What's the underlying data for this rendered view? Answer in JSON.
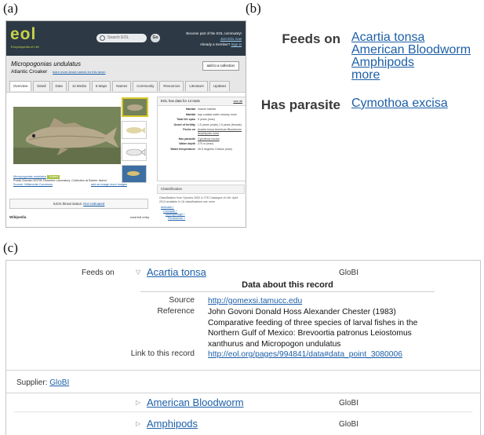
{
  "labels": {
    "a": "(a)",
    "b": "(b)",
    "c": "(c)"
  },
  "eol": {
    "logo": "eol",
    "tagline": "Encyclopedia of Life",
    "search_placeholder": "Search EOL",
    "go_label": "Go",
    "account": {
      "line1": "Become part of the EOL community!",
      "join_link": "Join EOL now",
      "line2": "Already a member?",
      "signin_link": "Sign in"
    },
    "scientific_name": "Micropogonias undulatus",
    "common_name": "Atlantic Croaker",
    "common_name_link": "learn more about names for this taxon",
    "add_to_collection": "add to a collection",
    "tabs": [
      "Overview",
      "Detail",
      "Data",
      "14 Media",
      "6 Maps",
      "Names",
      "Community",
      "Resources",
      "Literature",
      "Updates"
    ],
    "traits_header": "EOL has data for 14 traits",
    "see_all": "see all",
    "traits": [
      {
        "k": "Habitat",
        "v": "marine habitat"
      },
      {
        "k": "Habitat",
        "v": "bay coastal water estuary more"
      },
      {
        "k": "Total life span",
        "v": "9 years (max)"
      },
      {
        "k": "Onset of fertility",
        "v": "1.5 years (male) 1.5 years (female)"
      },
      {
        "k": "Feeds on",
        "v": "Acartia tonsa American Bloodworm Amphipods more"
      },
      {
        "k": "Has parasite",
        "v": "Cymothoa excisa"
      },
      {
        "k": "Water depth",
        "v": "270 m (max)"
      },
      {
        "k": "Water temperature",
        "v": "26.5 degrees Celsius (max)"
      }
    ],
    "classification_header": "Classification",
    "classification_text": "Classification from Species 2000 & ITIS Catalogue of Life: April 2013 available in 18 classifications  see more",
    "class_tree": [
      "Animalia +",
      "Chordata +",
      "Actinopterygii +",
      "Perciformes +"
    ],
    "caption_name": "Micropogonias undulatus",
    "trusted_label": "Trusted",
    "caption_text": "Public Domain  NSTIB Fisheries Laboratory, Collection at Barrier Island",
    "caption_source": "Source: Wikimedia Commons",
    "add_links": "add an image  more images",
    "iucn_text": "IUCN threat status:",
    "iucn_link": "Not evaluated",
    "wiki_title": "Wikipedia",
    "read_full": "read full entry"
  },
  "summary": {
    "rows": [
      {
        "key": "Feeds on",
        "values": [
          "Acartia tonsa",
          "American Bloodworm",
          "Amphipods",
          "more"
        ]
      },
      {
        "key": "Has parasite",
        "values": [
          "Cymothoa excisa"
        ]
      }
    ]
  },
  "detail": {
    "feeds_label": "Feeds on",
    "first_item": {
      "name": "Acartia tonsa",
      "provider": "GloBI"
    },
    "section_title": "Data about this record",
    "meta": {
      "source_label": "Source",
      "source_value": "http://gomexsi.tamucc.edu",
      "reference_label": "Reference",
      "reference_lines": [
        "John Govoni Donald Hoss Alexander Chester (1983)",
        "Comparative feeding of three species of larval fishes in the",
        "Northern Gulf of Mexico: Brevoortia patronus Leiostomus",
        "xanthurus and Micropogon undulatus"
      ],
      "link_label": "Link to this record",
      "link_value": "http://eol.org/pages/994841/data#data_point_3080006"
    },
    "supplier_label": "Supplier:",
    "supplier_value": "GloBI",
    "other_items": [
      {
        "name": "American Bloodworm",
        "provider": "GloBI"
      },
      {
        "name": "Amphipods",
        "provider": "GloBI"
      }
    ]
  }
}
